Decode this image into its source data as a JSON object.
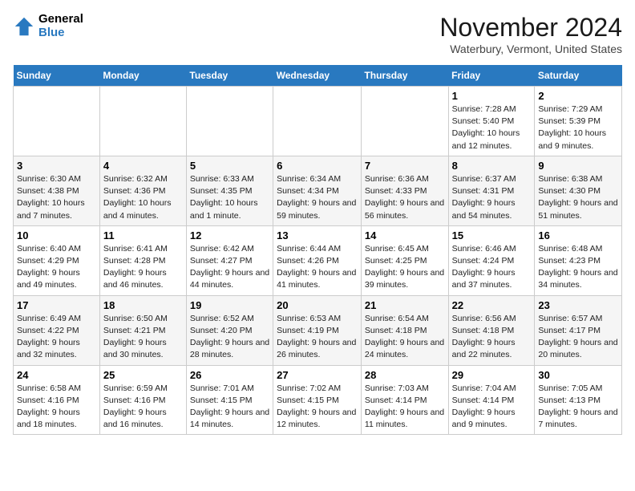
{
  "header": {
    "logo_line1": "General",
    "logo_line2": "Blue",
    "month_title": "November 2024",
    "location": "Waterbury, Vermont, United States"
  },
  "weekdays": [
    "Sunday",
    "Monday",
    "Tuesday",
    "Wednesday",
    "Thursday",
    "Friday",
    "Saturday"
  ],
  "weeks": [
    [
      {
        "day": "",
        "info": ""
      },
      {
        "day": "",
        "info": ""
      },
      {
        "day": "",
        "info": ""
      },
      {
        "day": "",
        "info": ""
      },
      {
        "day": "",
        "info": ""
      },
      {
        "day": "1",
        "info": "Sunrise: 7:28 AM\nSunset: 5:40 PM\nDaylight: 10 hours and 12 minutes."
      },
      {
        "day": "2",
        "info": "Sunrise: 7:29 AM\nSunset: 5:39 PM\nDaylight: 10 hours and 9 minutes."
      }
    ],
    [
      {
        "day": "3",
        "info": "Sunrise: 6:30 AM\nSunset: 4:38 PM\nDaylight: 10 hours and 7 minutes."
      },
      {
        "day": "4",
        "info": "Sunrise: 6:32 AM\nSunset: 4:36 PM\nDaylight: 10 hours and 4 minutes."
      },
      {
        "day": "5",
        "info": "Sunrise: 6:33 AM\nSunset: 4:35 PM\nDaylight: 10 hours and 1 minute."
      },
      {
        "day": "6",
        "info": "Sunrise: 6:34 AM\nSunset: 4:34 PM\nDaylight: 9 hours and 59 minutes."
      },
      {
        "day": "7",
        "info": "Sunrise: 6:36 AM\nSunset: 4:33 PM\nDaylight: 9 hours and 56 minutes."
      },
      {
        "day": "8",
        "info": "Sunrise: 6:37 AM\nSunset: 4:31 PM\nDaylight: 9 hours and 54 minutes."
      },
      {
        "day": "9",
        "info": "Sunrise: 6:38 AM\nSunset: 4:30 PM\nDaylight: 9 hours and 51 minutes."
      }
    ],
    [
      {
        "day": "10",
        "info": "Sunrise: 6:40 AM\nSunset: 4:29 PM\nDaylight: 9 hours and 49 minutes."
      },
      {
        "day": "11",
        "info": "Sunrise: 6:41 AM\nSunset: 4:28 PM\nDaylight: 9 hours and 46 minutes."
      },
      {
        "day": "12",
        "info": "Sunrise: 6:42 AM\nSunset: 4:27 PM\nDaylight: 9 hours and 44 minutes."
      },
      {
        "day": "13",
        "info": "Sunrise: 6:44 AM\nSunset: 4:26 PM\nDaylight: 9 hours and 41 minutes."
      },
      {
        "day": "14",
        "info": "Sunrise: 6:45 AM\nSunset: 4:25 PM\nDaylight: 9 hours and 39 minutes."
      },
      {
        "day": "15",
        "info": "Sunrise: 6:46 AM\nSunset: 4:24 PM\nDaylight: 9 hours and 37 minutes."
      },
      {
        "day": "16",
        "info": "Sunrise: 6:48 AM\nSunset: 4:23 PM\nDaylight: 9 hours and 34 minutes."
      }
    ],
    [
      {
        "day": "17",
        "info": "Sunrise: 6:49 AM\nSunset: 4:22 PM\nDaylight: 9 hours and 32 minutes."
      },
      {
        "day": "18",
        "info": "Sunrise: 6:50 AM\nSunset: 4:21 PM\nDaylight: 9 hours and 30 minutes."
      },
      {
        "day": "19",
        "info": "Sunrise: 6:52 AM\nSunset: 4:20 PM\nDaylight: 9 hours and 28 minutes."
      },
      {
        "day": "20",
        "info": "Sunrise: 6:53 AM\nSunset: 4:19 PM\nDaylight: 9 hours and 26 minutes."
      },
      {
        "day": "21",
        "info": "Sunrise: 6:54 AM\nSunset: 4:18 PM\nDaylight: 9 hours and 24 minutes."
      },
      {
        "day": "22",
        "info": "Sunrise: 6:56 AM\nSunset: 4:18 PM\nDaylight: 9 hours and 22 minutes."
      },
      {
        "day": "23",
        "info": "Sunrise: 6:57 AM\nSunset: 4:17 PM\nDaylight: 9 hours and 20 minutes."
      }
    ],
    [
      {
        "day": "24",
        "info": "Sunrise: 6:58 AM\nSunset: 4:16 PM\nDaylight: 9 hours and 18 minutes."
      },
      {
        "day": "25",
        "info": "Sunrise: 6:59 AM\nSunset: 4:16 PM\nDaylight: 9 hours and 16 minutes."
      },
      {
        "day": "26",
        "info": "Sunrise: 7:01 AM\nSunset: 4:15 PM\nDaylight: 9 hours and 14 minutes."
      },
      {
        "day": "27",
        "info": "Sunrise: 7:02 AM\nSunset: 4:15 PM\nDaylight: 9 hours and 12 minutes."
      },
      {
        "day": "28",
        "info": "Sunrise: 7:03 AM\nSunset: 4:14 PM\nDaylight: 9 hours and 11 minutes."
      },
      {
        "day": "29",
        "info": "Sunrise: 7:04 AM\nSunset: 4:14 PM\nDaylight: 9 hours and 9 minutes."
      },
      {
        "day": "30",
        "info": "Sunrise: 7:05 AM\nSunset: 4:13 PM\nDaylight: 9 hours and 7 minutes."
      }
    ]
  ]
}
